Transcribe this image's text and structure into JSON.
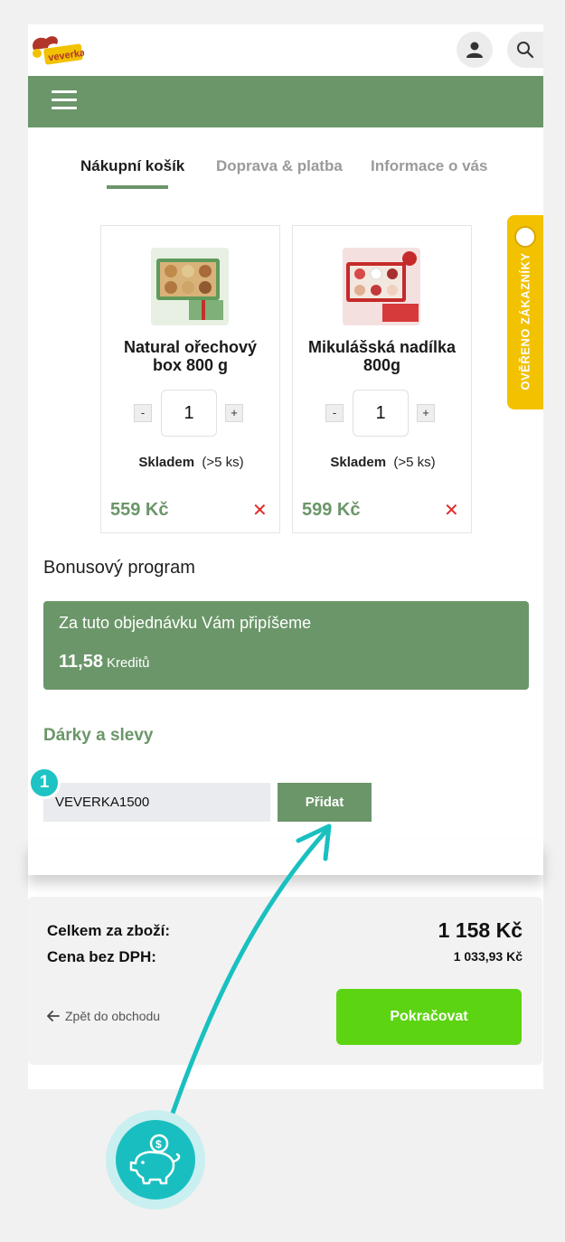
{
  "header": {
    "logo_text": "veverka",
    "user_icon": "user-icon",
    "search_icon": "search-icon",
    "menu_icon": "hamburger-icon"
  },
  "steps": [
    "Nákupní košík",
    "Doprava & platba",
    "Informace o vás"
  ],
  "verified_tab": {
    "label": "OVĚŘENO ZÁKAZNÍKY"
  },
  "cart": {
    "items": [
      {
        "name": "Natural ořechový box 800 g",
        "quantity": "1",
        "minus": "-",
        "plus": "+",
        "stock_label": "Skladem",
        "stock_qty": "(>5 ks)",
        "price": "559 Kč",
        "remove": "✕"
      },
      {
        "name": "Mikulášská nadílka 800g",
        "quantity": "1",
        "minus": "-",
        "plus": "+",
        "stock_label": "Skladem",
        "stock_qty": "(>5 ks)",
        "price": "599 Kč",
        "remove": "✕"
      }
    ]
  },
  "bonus": {
    "title": "Bonusový program",
    "line": "Za tuto objednávku Vám připíšeme",
    "amount": "11,58",
    "unit": "Kreditů"
  },
  "gifts": {
    "title": "Dárky a slevy",
    "coupon_value": "VEVERKA1500",
    "add_label": "Přidat",
    "step_number": "1"
  },
  "summary": {
    "total_label": "Celkem za zboží:",
    "total_value": "1 158 Kč",
    "net_label": "Cena bez DPH:",
    "net_value": "1 033,93 Kč",
    "back_label": "Zpět do obchodu",
    "continue_label": "Pokračovat"
  },
  "colors": {
    "brand_green": "#6b9669",
    "cta_green": "#5cd412",
    "annotation_teal": "#19bfc0",
    "verified_yellow": "#f2c200"
  }
}
